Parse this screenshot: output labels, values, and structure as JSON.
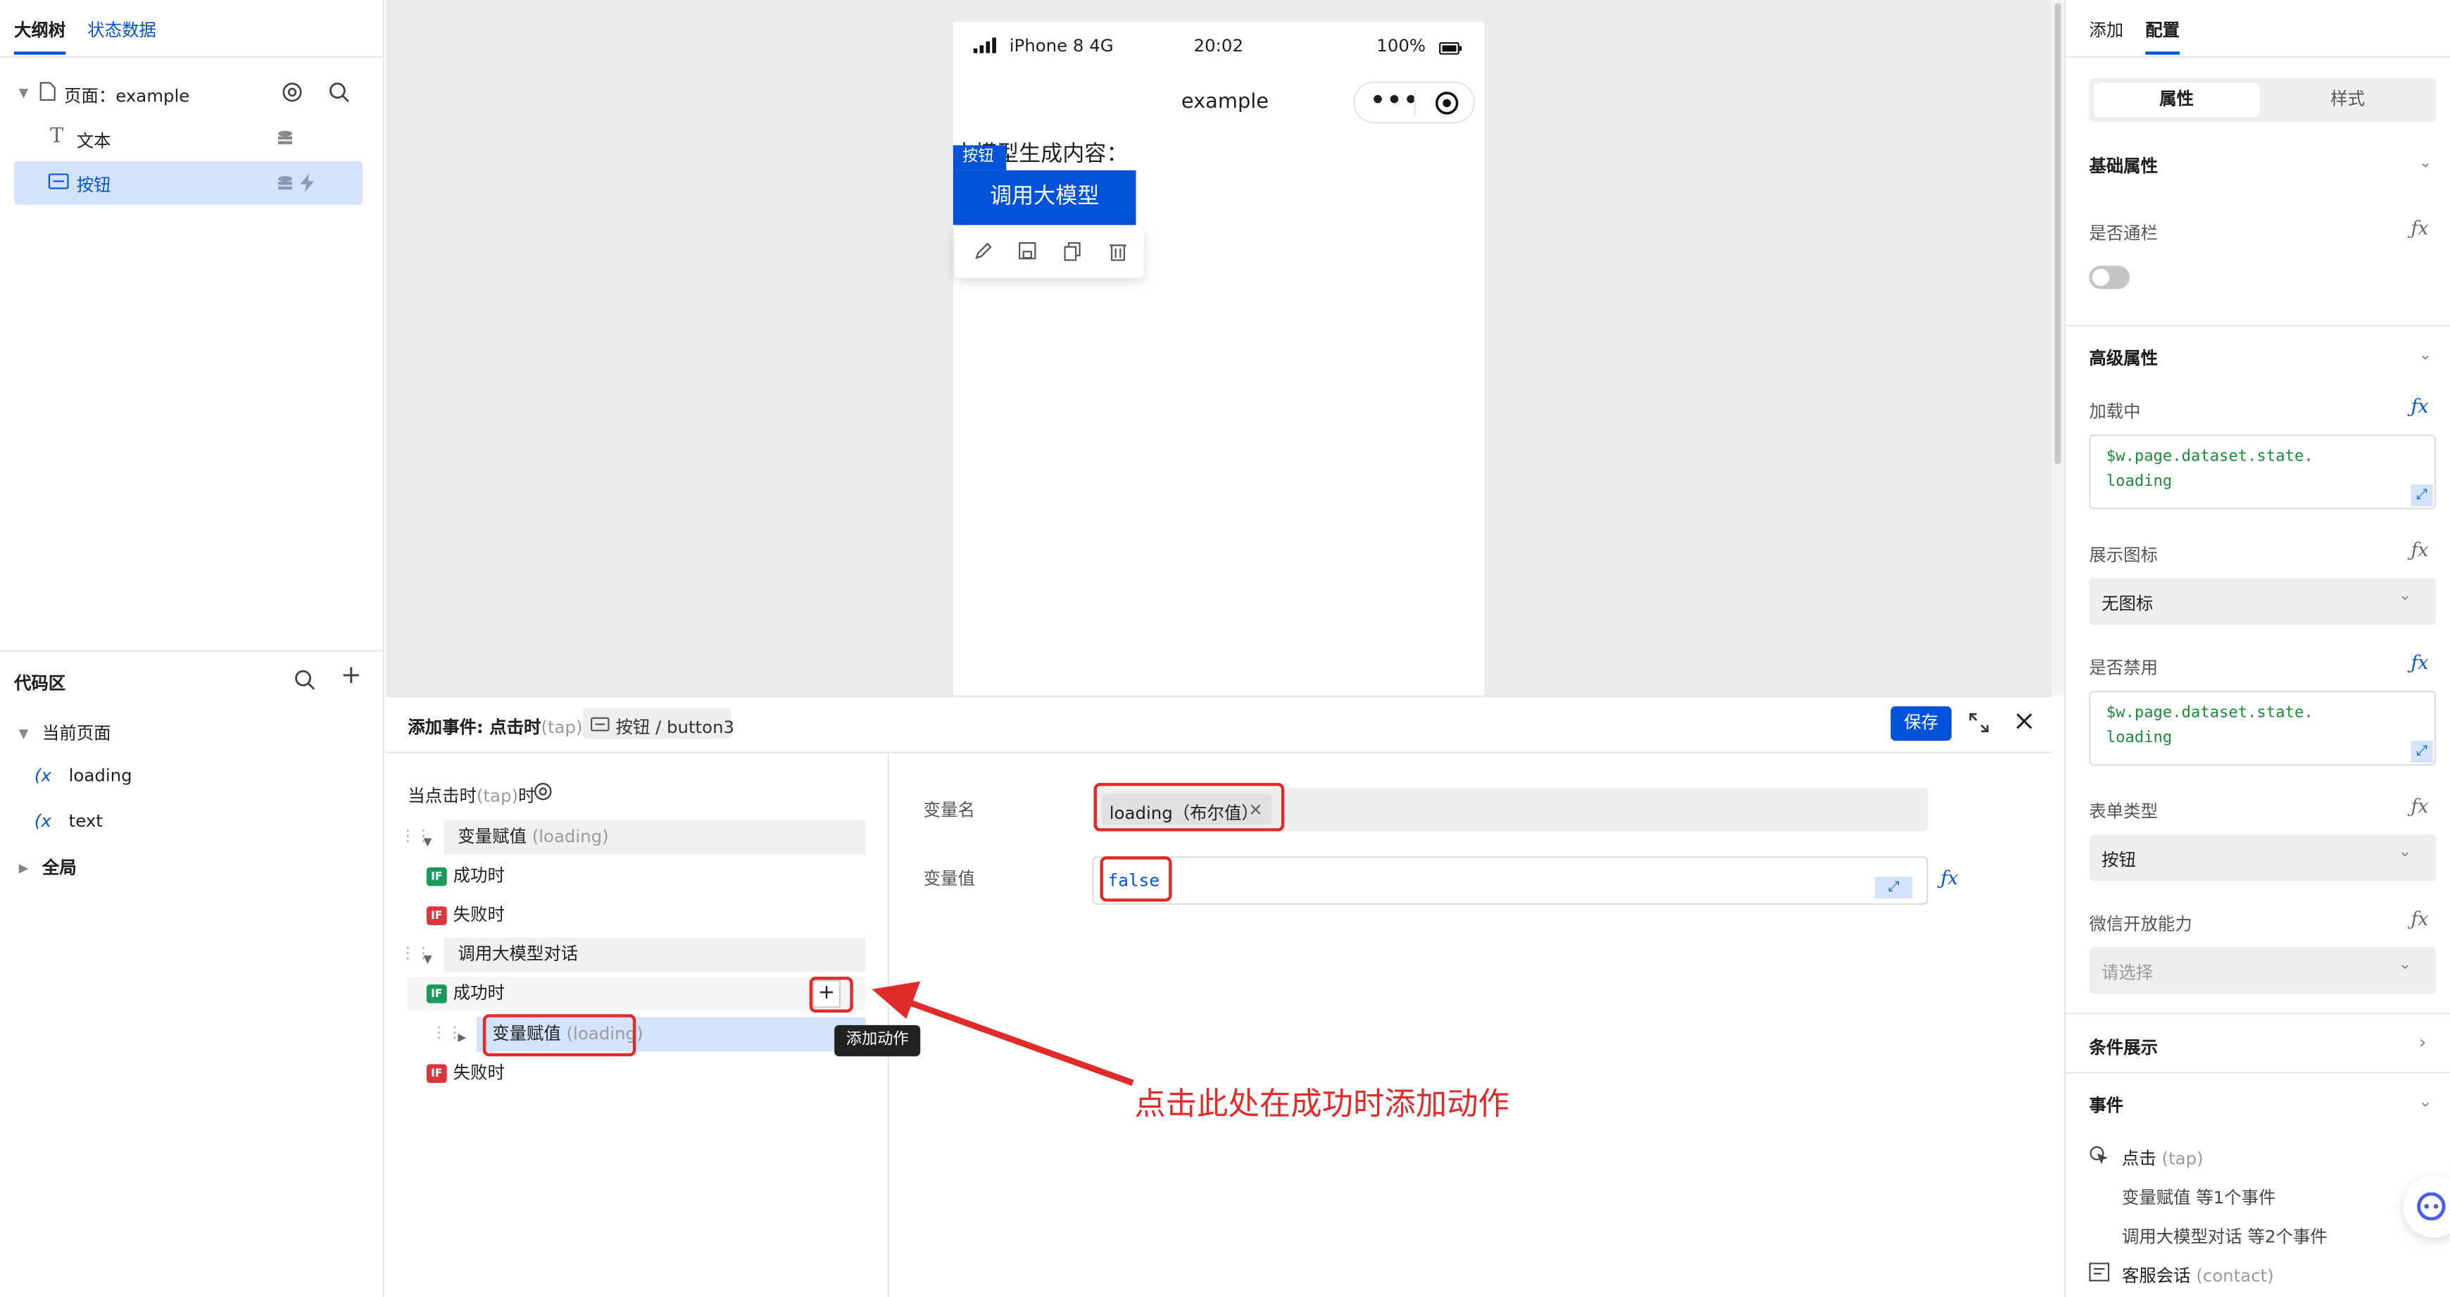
{
  "left_panel": {
    "tabs": [
      "大纲树",
      "状态数据"
    ],
    "tree": {
      "page_label": "页面：example",
      "text_item": "文本",
      "button_item": "按钮"
    },
    "code_area": {
      "title": "代码区",
      "current_page": "当前页面",
      "vars": [
        "loading",
        "text"
      ],
      "global": "全局"
    }
  },
  "phone": {
    "status": {
      "carrier": "iPhone 8  4G",
      "time": "20:02",
      "battery": "100%"
    },
    "nav_title": "example",
    "content_text": "大模型生成内容：",
    "selected_tag": "按钮",
    "button_text": "调用大模型"
  },
  "right_panel": {
    "tabs": [
      "添加",
      "配置"
    ],
    "subtabs": [
      "属性",
      "样式"
    ],
    "basic_section": "基础属性",
    "full_width_label": "是否通栏",
    "advanced_section": "高级属性",
    "loading_label": "加载中",
    "loading_expr": "$w.page.dataset.state.\nloading",
    "show_icon_label": "展示图标",
    "show_icon_value": "无图标",
    "disabled_label": "是否禁用",
    "disabled_expr": "$w.page.dataset.state.\nloading",
    "form_type_label": "表单类型",
    "form_type_value": "按钮",
    "wechat_label": "微信开放能力",
    "wechat_placeholder": "请选择",
    "condition_section": "条件展示",
    "events_section": "事件",
    "event_tap": "点击",
    "event_tap_sub": "(tap)",
    "event_tap_actions": [
      "变量赋值 等1个事件",
      "调用大模型对话 等2个事件"
    ],
    "event_contact": "客服会话",
    "event_contact_sub": "(contact)"
  },
  "editor": {
    "title": "添加事件: 点击时",
    "title_sub": "(tap)",
    "component_path": "按钮 / button3",
    "save_label": "保存",
    "trigger_label": "当点击时",
    "trigger_sub": "(tap)",
    "trigger_suffix": "时",
    "actions": {
      "assign1": "变量赋值",
      "assign1_sub": "(loading)",
      "success": "成功时",
      "fail": "失败时",
      "llm": "调用大模型对话",
      "assign2": "变量赋值",
      "assign2_sub": "(loading)",
      "if_badge": "IF"
    },
    "tooltip_add": "添加动作",
    "var_name_label": "变量名",
    "var_name_value": "loading（布尔值）",
    "var_value_label": "变量值",
    "var_value": "false"
  },
  "annotation": {
    "text": "点击此处在成功时添加动作",
    "color": "#e02b2b"
  },
  "colors": {
    "brand": "#0052d9",
    "if_success": "#1a9b5b",
    "if_fail": "#d9363e"
  }
}
